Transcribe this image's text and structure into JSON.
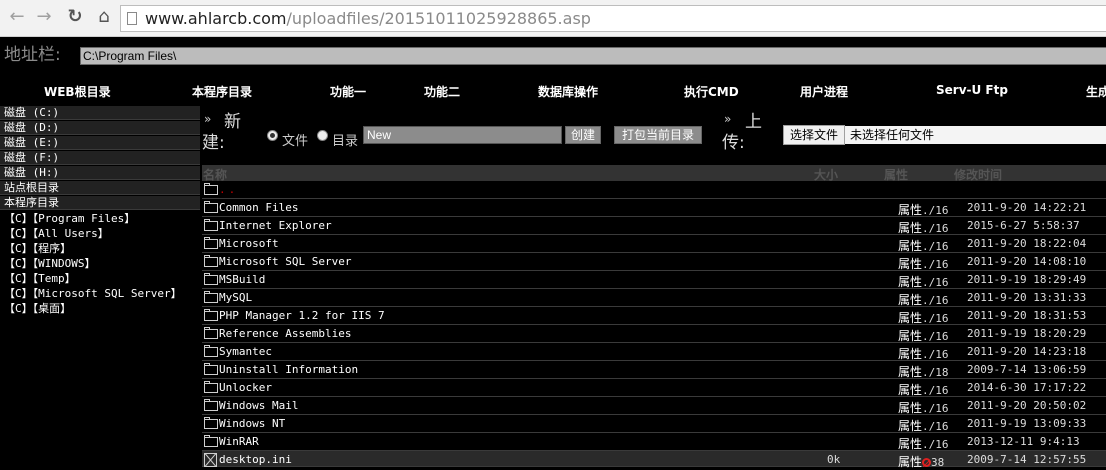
{
  "browser": {
    "url_host": "www.ahlarcb.com",
    "url_path": "/uploadfiles/20151011025928865.asp"
  },
  "address_bar": {
    "label": "地址栏:",
    "value": "C:\\Program Files\\"
  },
  "menu": {
    "items": [
      "WEB根目录",
      "本程序目录",
      "功能一",
      "功能二",
      "数据库操作",
      "执行CMD",
      "用户进程",
      "Serv-U Ftp",
      "生成"
    ]
  },
  "left_panel": {
    "drives": [
      "磁盘  (C:)",
      "磁盘  (D:)",
      "磁盘  (E:)",
      "磁盘  (F:)",
      "磁盘  (H:)"
    ],
    "site_root": "站点根目录",
    "program_dir": "本程序目录",
    "shortcuts": [
      "【C】【Program Files】",
      "【C】【All Users】",
      "【C】【程序】",
      "【C】【WINDOWS】",
      "【C】【Temp】",
      "【C】【Microsoft SQL Server】",
      "【C】【桌面】"
    ]
  },
  "toolbar": {
    "new_label_1": "新",
    "new_label_2": "建:",
    "radio_file": "文件",
    "radio_dir": "目录",
    "new_input_value": "New",
    "create_button": "创建",
    "pack_button": "打包当前目录",
    "upload_label_1": "上",
    "upload_label_2": "传:",
    "choose_file_button": "选择文件",
    "no_file_text": "未选择任何文件"
  },
  "table": {
    "headers": {
      "name": "名称",
      "size": "大小",
      "attr": "属性",
      "mtime": "修改时间"
    },
    "parent": "..",
    "rows": [
      {
        "name": "Common Files",
        "attr": "属性",
        "num": "./16",
        "mtime": "2011-9-20 14:22:21"
      },
      {
        "name": "Internet Explorer",
        "attr": "属性",
        "num": "./16",
        "mtime": "2015-6-27 5:58:37"
      },
      {
        "name": "Microsoft",
        "attr": "属性",
        "num": "./16",
        "mtime": "2011-9-20 18:22:04"
      },
      {
        "name": "Microsoft SQL Server",
        "attr": "属性",
        "num": "./16",
        "mtime": "2011-9-20 14:08:10"
      },
      {
        "name": "MSBuild",
        "attr": "属性",
        "num": "./16",
        "mtime": "2011-9-19 18:29:49"
      },
      {
        "name": "MySQL",
        "attr": "属性",
        "num": "./16",
        "mtime": "2011-9-20 13:31:33"
      },
      {
        "name": "PHP Manager 1.2 for IIS 7",
        "attr": "属性",
        "num": "./16",
        "mtime": "2011-9-20 18:31:53"
      },
      {
        "name": "Reference Assemblies",
        "attr": "属性",
        "num": "./16",
        "mtime": "2011-9-19 18:20:29"
      },
      {
        "name": "Symantec",
        "attr": "属性",
        "num": "./16",
        "mtime": "2011-9-20 14:23:18"
      },
      {
        "name": "Uninstall Information",
        "attr": "属性",
        "num": "./18",
        "mtime": "2009-7-14 13:06:59"
      },
      {
        "name": "Unlocker",
        "attr": "属性",
        "num": "./16",
        "mtime": "2014-6-30 17:17:22"
      },
      {
        "name": "Windows Mail",
        "attr": "属性",
        "num": "./16",
        "mtime": "2011-9-20 20:50:02"
      },
      {
        "name": "Windows NT",
        "attr": "属性",
        "num": "./16",
        "mtime": "2011-9-19 13:09:33"
      },
      {
        "name": "WinRAR",
        "attr": "属性",
        "num": "./16",
        "mtime": "2013-12-11 9:4:13"
      }
    ],
    "file": {
      "name": "desktop.ini",
      "size": "0k",
      "attr": "属性",
      "num": "38",
      "mtime": "2009-7-14 12:57:55"
    }
  }
}
